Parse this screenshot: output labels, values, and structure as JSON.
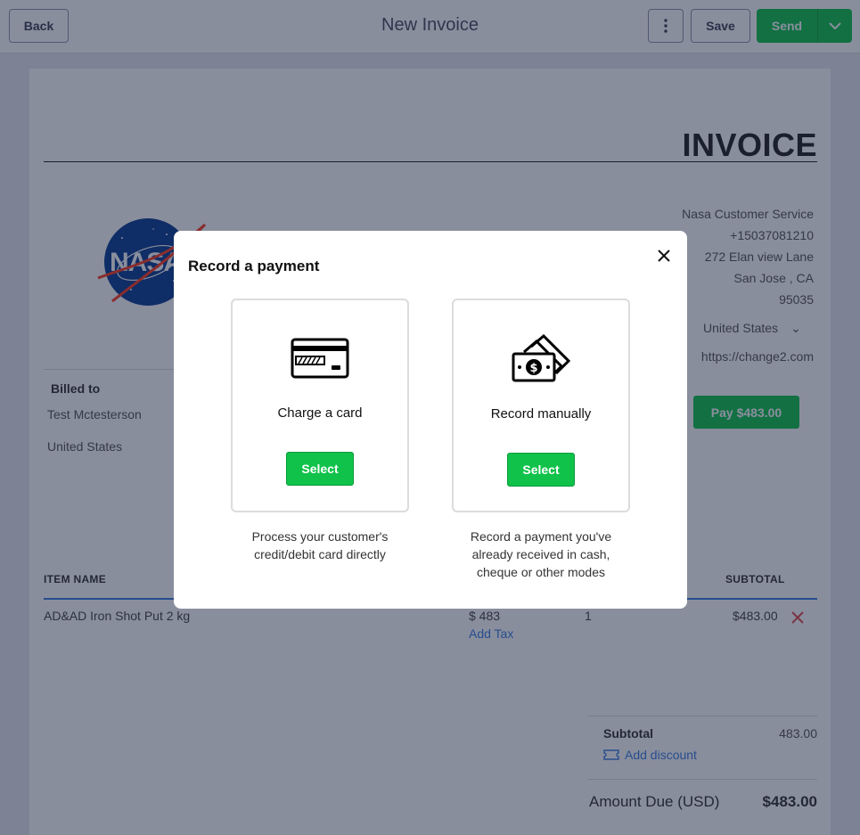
{
  "header": {
    "back_label": "Back",
    "title": "New Invoice",
    "save_label": "Save",
    "send_label": "Send"
  },
  "invoice": {
    "heading": "INVOICE",
    "logo_text": "NASA",
    "seller": {
      "name": "Nasa Customer Service",
      "phone": "+15037081210",
      "street": "272 Elan view Lane",
      "city_state": "San Jose ,  CA",
      "zip": "95035",
      "country": "United States",
      "website": "https://change2.com"
    },
    "pay_button": "Pay $483.00",
    "billed_to": {
      "label": "Billed to",
      "name": "Test Mctesterson",
      "country": "United States"
    },
    "columns": {
      "item_name": "ITEM NAME",
      "subtotal": "SUBTOTAL"
    },
    "items": [
      {
        "name": "AD&AD Iron Shot Put 2 kg",
        "price": "$  483",
        "add_tax": "Add Tax",
        "qty": "1",
        "subtotal": "$483.00"
      }
    ],
    "summary": {
      "subtotal_label": "Subtotal",
      "subtotal_value": "483.00",
      "add_discount": "Add discount",
      "amount_due_label": "Amount Due (USD)",
      "amount_due_value": "$483.00"
    }
  },
  "modal": {
    "title": "Record a payment",
    "options": [
      {
        "label": "Charge a card",
        "button": "Select",
        "description_line1": "Process your customer's",
        "description_line2": "credit/debit card directly",
        "icon": "credit-card-icon"
      },
      {
        "label": "Record manually",
        "button": "Select",
        "description_line1": "Record a payment you've",
        "description_line2": "already received in cash,",
        "description_line3": "cheque or other modes",
        "icon": "cash-icon"
      }
    ]
  },
  "colors": {
    "accent_green": "#10c24a",
    "link_blue": "#3b7ddd",
    "danger_red": "#e04848"
  }
}
